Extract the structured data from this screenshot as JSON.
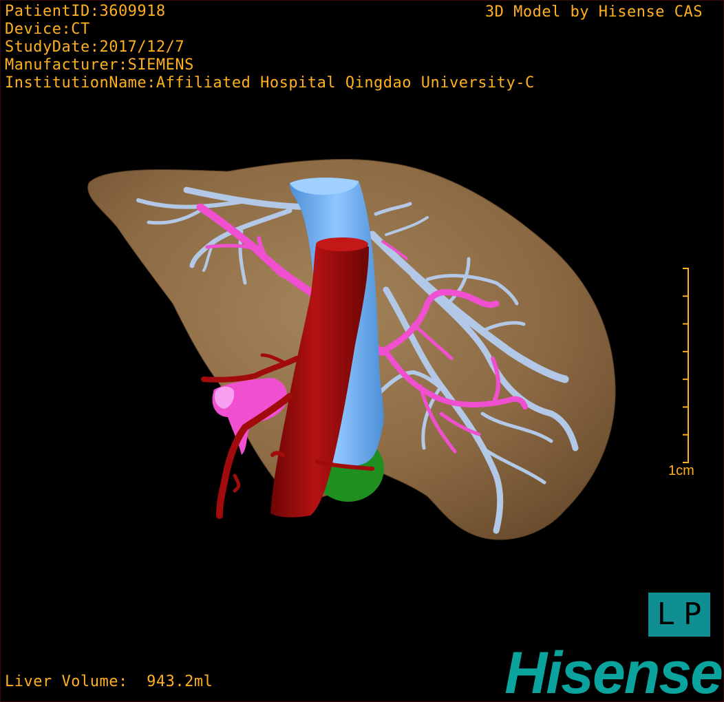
{
  "patient_info": {
    "patient_id": "PatientID:3609918",
    "device": "Device:CT",
    "study_date": "StudyDate:2017/12/7",
    "manufacturer": "Manufacturer:SIEMENS",
    "institution": "InstitutionName:Affiliated Hospital Qingdao University-C"
  },
  "credit": "3D Model by Hisense CAS",
  "scale": {
    "label": "1cm",
    "ticks": 8
  },
  "orientation": {
    "label": "LP"
  },
  "brand": {
    "logo_text": "Hisense"
  },
  "measurement": {
    "liver_volume": "Liver Volume:  943.2ml"
  },
  "colors": {
    "overlay_text": "#ffb020",
    "liver": "#8c6a44",
    "hepatic_vein": "#b3c8e6",
    "vena_cava": "#6eb0f0",
    "aorta": "#a10b0b",
    "portal_vein": "#f050d0",
    "gallbladder": "#1f8f1f",
    "orientation_cube": "#0f8f92",
    "brand": "#0aa39e"
  }
}
